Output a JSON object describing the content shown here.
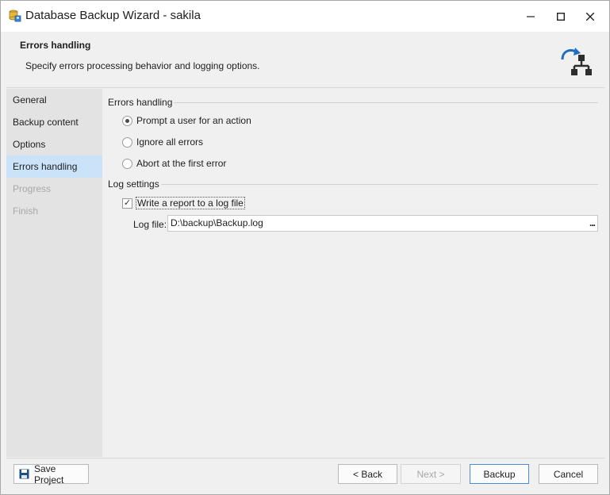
{
  "window": {
    "title": "Database Backup Wizard - sakila",
    "icon": "database-backup-app-icon"
  },
  "header": {
    "title": "Errors handling",
    "subtitle": "Specify errors processing behavior and logging options.",
    "icon": "backup-network-icon",
    "accent_color": "#1f6fbf"
  },
  "nav": {
    "items": [
      {
        "label": "General",
        "state": "normal"
      },
      {
        "label": "Backup content",
        "state": "normal"
      },
      {
        "label": "Options",
        "state": "normal"
      },
      {
        "label": "Errors handling",
        "state": "active"
      },
      {
        "label": "Progress",
        "state": "disabled"
      },
      {
        "label": "Finish",
        "state": "disabled"
      }
    ]
  },
  "errors_group": {
    "title": "Errors handling",
    "options": [
      {
        "label": "Prompt a user for an action",
        "checked": true
      },
      {
        "label": "Ignore all errors",
        "checked": false
      },
      {
        "label": "Abort at the first error",
        "checked": false
      }
    ]
  },
  "log_group": {
    "title": "Log settings",
    "write_report_label": "Write a report to a log file",
    "write_report_checked": true,
    "log_file_label": "Log file:",
    "log_file_value": "D:\\backup\\Backup.log",
    "browse_label": "..."
  },
  "footer": {
    "save_project": "Save Project",
    "back": "< Back",
    "next": "Next >",
    "backup": "Backup",
    "cancel": "Cancel"
  }
}
